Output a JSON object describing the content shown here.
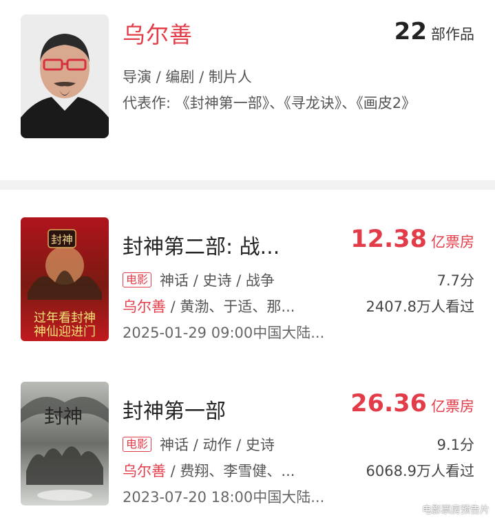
{
  "profile": {
    "name": "乌尔善",
    "works_count": "22",
    "works_label": "部作品",
    "roles": "导演 / 编剧 / 制片人",
    "rep_works": "代表作: 《封神第一部》、《寻龙诀》、《画皮2》"
  },
  "movies": [
    {
      "title": "封神第二部: 战...",
      "boxoffice": "12.38",
      "boxoffice_unit": "亿票房",
      "tag": "电影",
      "genres": "神话 / 史诗 / 战争",
      "score": "7.7分",
      "director": "乌尔善",
      "cast": " / 黄渤、于适、那...",
      "views": "2407.8万人看过",
      "release": "2025-01-29 09:00中国大陆...",
      "poster_text_1": "过年看封神",
      "poster_text_2": "神仙迎进门",
      "poster_logo": "封神"
    },
    {
      "title": "封神第一部",
      "boxoffice": "26.36",
      "boxoffice_unit": "亿票房",
      "tag": "电影",
      "genres": "神话 / 动作 / 史诗",
      "score": "9.1分",
      "director": "乌尔善",
      "cast": " / 费翔、李雪健、...",
      "views": "6068.9万人看过",
      "release": "2023-07-20 18:00中国大陆...",
      "poster_logo": "封神"
    }
  ],
  "watermark": "电影票房预告片",
  "colors": {
    "accent": "#e23c48",
    "divider": "#f2f2f2"
  }
}
